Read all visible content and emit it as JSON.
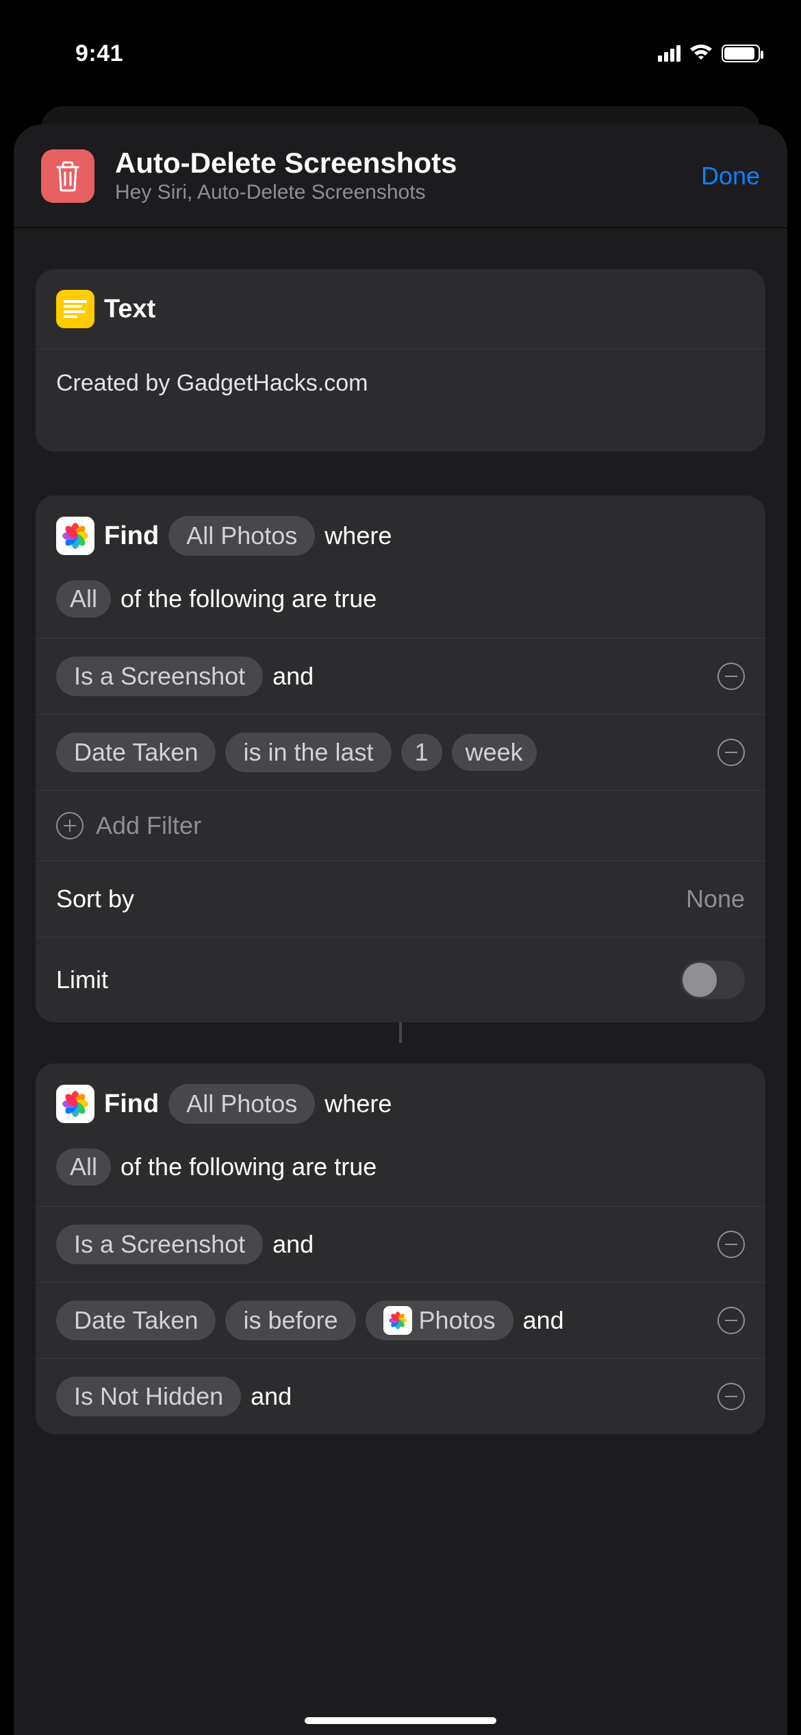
{
  "status": {
    "time": "9:41"
  },
  "header": {
    "title": "Auto-Delete Screenshots",
    "subtitle": "Hey Siri, Auto-Delete Screenshots",
    "done": "Done"
  },
  "text_action": {
    "label": "Text",
    "content": "Created by GadgetHacks.com"
  },
  "find1": {
    "find": "Find",
    "source": "All Photos",
    "where": "where",
    "match": "All",
    "of_true": "of the following are true",
    "filters": {
      "f1": {
        "cond": "Is a Screenshot",
        "conj": "and"
      },
      "f2": {
        "field": "Date Taken",
        "op": "is in the last",
        "num": "1",
        "unit": "week"
      }
    },
    "add_filter": "Add Filter",
    "sort_by_label": "Sort by",
    "sort_by_value": "None",
    "limit_label": "Limit"
  },
  "find2": {
    "find": "Find",
    "source": "All Photos",
    "where": "where",
    "match": "All",
    "of_true": "of the following are true",
    "filters": {
      "f1": {
        "cond": "Is a Screenshot",
        "conj": "and"
      },
      "f2": {
        "field": "Date Taken",
        "op": "is before",
        "var": "Photos",
        "conj": "and"
      },
      "f3": {
        "cond": "Is Not Hidden",
        "conj": "and"
      }
    }
  }
}
